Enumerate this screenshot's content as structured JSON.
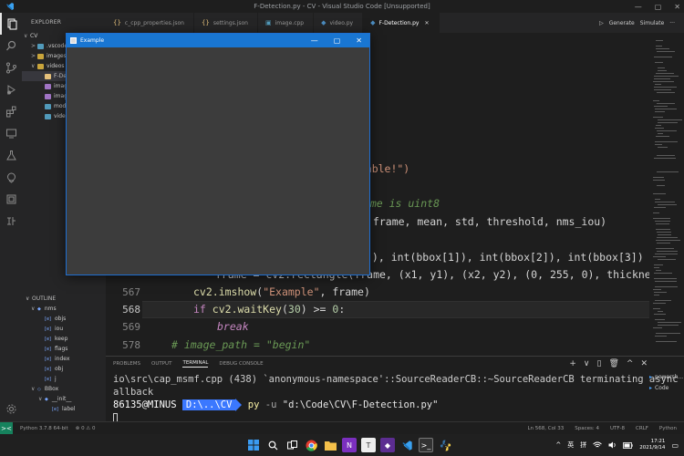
{
  "titlebar": {
    "title": "F-Detection.py - CV - Visual Studio Code [Unsupported]",
    "minimize": "—",
    "restore": "▢",
    "close": "✕"
  },
  "activity": {
    "icons": [
      "explorer-icon",
      "search-icon",
      "source-control-icon",
      "run-debug-icon",
      "extensions-icon",
      "remote-explorer-icon",
      "testing-icon",
      "docker-icon",
      "jupyter-icon",
      "zhi-extension-icon"
    ]
  },
  "sidebar": {
    "header": "EXPLORER",
    "items": [
      {
        "label": "CV",
        "chevron": "∨"
      },
      {
        "label": ".vscode",
        "chevron": ">"
      },
      {
        "label": "images",
        "chevron": ">"
      },
      {
        "label": "videos",
        "chevron": "∨"
      },
      {
        "label": "F-Detection.py",
        "chevron": ""
      },
      {
        "label": "image",
        "chevron": ""
      },
      {
        "label": "image",
        "chevron": ""
      },
      {
        "label": "model",
        "chevron": ""
      },
      {
        "label": "video",
        "chevron": ""
      }
    ],
    "outline_header": "OUTLINE",
    "outline": [
      {
        "label": "nms",
        "chevron": "∨",
        "sym": "◆"
      },
      {
        "label": "objs",
        "chevron": "",
        "sym": "[e]"
      },
      {
        "label": "iou",
        "chevron": "",
        "sym": "[e]"
      },
      {
        "label": "keep",
        "chevron": "",
        "sym": "[e]"
      },
      {
        "label": "flags",
        "chevron": "",
        "sym": "[e]"
      },
      {
        "label": "index",
        "chevron": "",
        "sym": "[e]"
      },
      {
        "label": "obj",
        "chevron": "",
        "sym": "[e]"
      },
      {
        "label": "j",
        "chevron": "",
        "sym": "[e]"
      },
      {
        "label": "BBox",
        "chevron": "∨",
        "sym": "◇"
      },
      {
        "label": "__init__",
        "chevron": "∨",
        "sym": "◆"
      },
      {
        "label": "label",
        "chevron": "",
        "sym": "[e]"
      }
    ]
  },
  "tabs": [
    {
      "icon": "{}",
      "label": "c_cpp_properties.json",
      "active": false
    },
    {
      "icon": "{}",
      "label": "settings.json",
      "active": false
    },
    {
      "icon": "▣",
      "label": "image.cpp",
      "active": false
    },
    {
      "icon": "◆",
      "label": "video.py",
      "active": false
    },
    {
      "icon": "◆",
      "label": "F-Detection.py",
      "active": true
    }
  ],
  "tab_actions": {
    "generate": "Generate",
    "simulate": "Simulate",
    "run": "▷",
    "more": "···"
  },
  "editor": {
    "frag1": "ailable!\")",
    "frag2": "rame is uint8",
    "frag3": " frame, mean, std, threshold, nms_iou)",
    "frag4": "]), int(bbox[1]), int(bbox[2]), int(bbox[3])",
    "frag5": "frame = cv2.rectangle(frame, (x1, y1), (x2, y2), (0, 255, 0), thickness=5)",
    "lines": [
      {
        "num": "567",
        "text": "cv2.imshow(\"Example\", frame)"
      },
      {
        "num": "568",
        "text": "if cv2.waitKey(30) >= 0:"
      },
      {
        "num": "569",
        "text": "break"
      },
      {
        "num": "578",
        "text": "# image_path = \"begin\""
      }
    ]
  },
  "panel": {
    "tabs": [
      "PROBLEMS",
      "OUTPUT",
      "TERMINAL",
      "DEBUG CONSOLE"
    ],
    "active_tab": "TERMINAL",
    "controls": [
      "+",
      "∨",
      "▯",
      "🗑",
      "^",
      "✕"
    ],
    "terminal": {
      "line1": "io\\src\\cap_msmf.cpp (438) `anonymous-namespace'::SourceReaderCB::~SourceReaderCB terminating async c",
      "line2": "allback",
      "prompt_user": "86135@MINUS",
      "prompt_path": "D:\\..\\CV",
      "cmd_py": "py",
      "cmd_flag": "-u",
      "cmd_path": "\"d:\\Code\\CV\\F-Detection.py\""
    },
    "termlist": [
      "powersh...",
      "Code"
    ]
  },
  "status": {
    "remote": "><",
    "python": "Python 3.7.8 64-bit",
    "errors": "⊗ 0 ⚠ 0",
    "right": [
      "Ln 568, Col 33",
      "Spaces: 4",
      "UTF-8",
      "CRLF",
      "Python"
    ]
  },
  "taskbar": {
    "clock_time": "17:21",
    "clock_date": "2021/9/14",
    "ime1": "英",
    "ime2": "拼",
    "tray": "^"
  },
  "window": {
    "title": "Example",
    "min": "—",
    "max": "▢",
    "close": "✕"
  },
  "colors": {
    "accent_blue": "#1976d2",
    "prompt_blue": "#3b78ff",
    "status_remote": "#16825d"
  }
}
